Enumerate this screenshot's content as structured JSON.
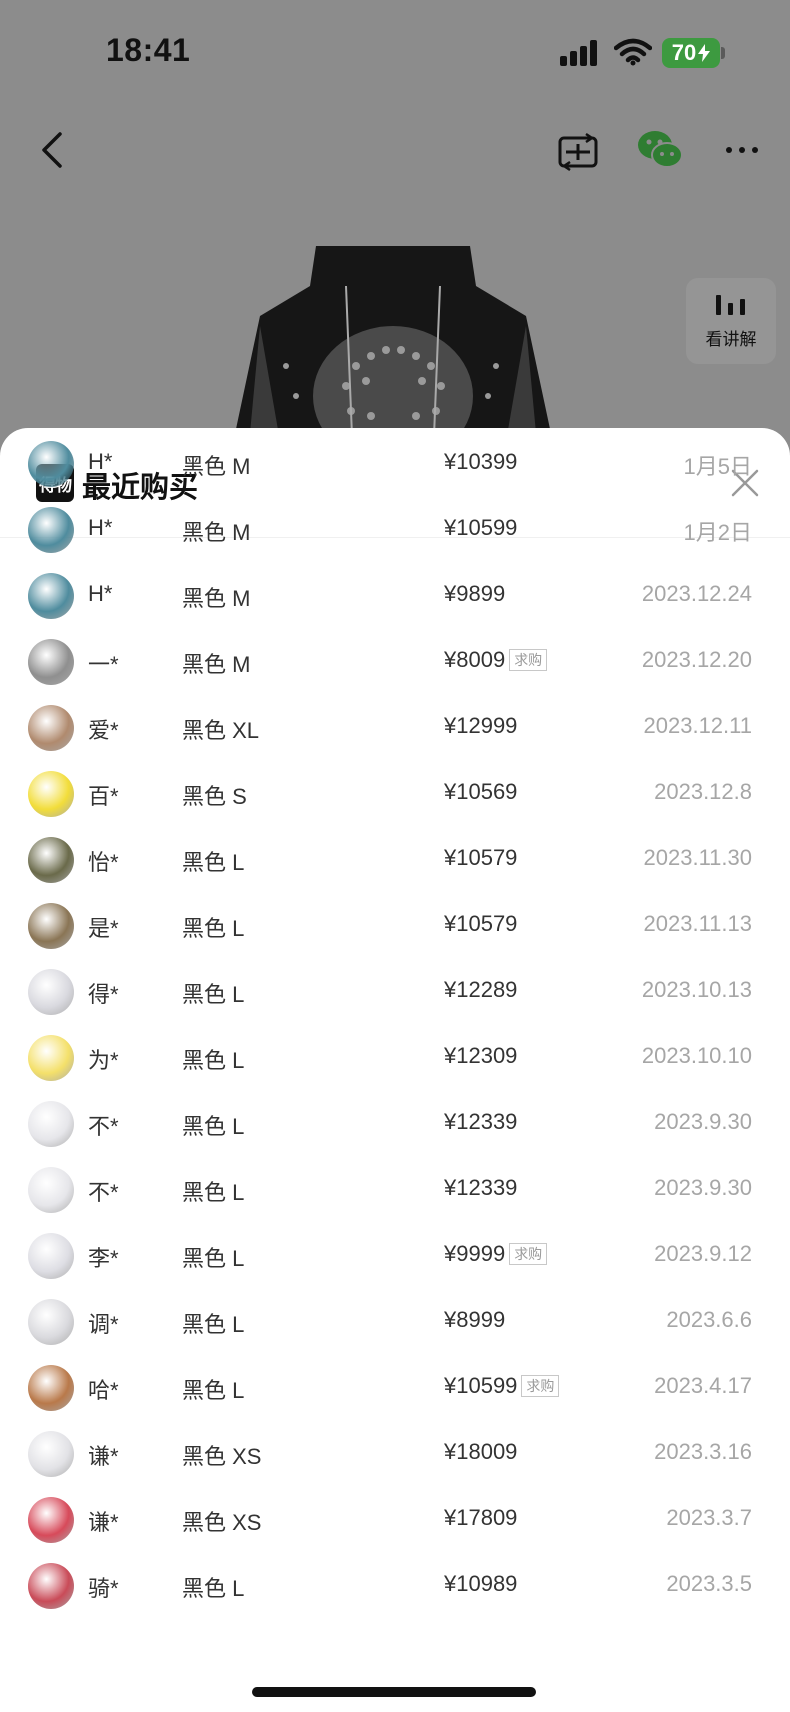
{
  "status_bar": {
    "time": "18:41",
    "battery": "70"
  },
  "nav": {
    "sell_label_icon": "sell-icon",
    "share_icon": "wechat-icon",
    "more_icon": "more-icon"
  },
  "explain": {
    "label": "看讲解"
  },
  "sheet": {
    "brand_logo": "得物",
    "title": "最近购买",
    "rows": [
      {
        "buyer": "H*",
        "spec": "黑色 M",
        "price": "¥10399",
        "tag": "",
        "date": "1月5日",
        "avatar_color": "#4f8c9e"
      },
      {
        "buyer": "H*",
        "spec": "黑色 M",
        "price": "¥10599",
        "tag": "",
        "date": "1月2日",
        "avatar_color": "#4f8c9e"
      },
      {
        "buyer": "H*",
        "spec": "黑色 M",
        "price": "¥9899",
        "tag": "",
        "date": "2023.12.24",
        "avatar_color": "#4f8c9e"
      },
      {
        "buyer": "一*",
        "spec": "黑色 M",
        "price": "¥8009",
        "tag": "求购",
        "date": "2023.12.20",
        "avatar_color": "#8f8f8f"
      },
      {
        "buyer": "爱*",
        "spec": "黑色 XL",
        "price": "¥12999",
        "tag": "",
        "date": "2023.12.11",
        "avatar_color": "#b08a6e"
      },
      {
        "buyer": "百*",
        "spec": "黑色 S",
        "price": "¥10569",
        "tag": "",
        "date": "2023.12.8",
        "avatar_color": "#f2dd3a"
      },
      {
        "buyer": "怡*",
        "spec": "黑色 L",
        "price": "¥10579",
        "tag": "",
        "date": "2023.11.30",
        "avatar_color": "#6a6a4a"
      },
      {
        "buyer": "是*",
        "spec": "黑色 L",
        "price": "¥10579",
        "tag": "",
        "date": "2023.11.13",
        "avatar_color": "#8a7555"
      },
      {
        "buyer": "得*",
        "spec": "黑色 L",
        "price": "¥12289",
        "tag": "",
        "date": "2023.10.13",
        "avatar_color": "#d9d9df"
      },
      {
        "buyer": "为*",
        "spec": "黑色 L",
        "price": "¥12309",
        "tag": "",
        "date": "2023.10.10",
        "avatar_color": "#f4e06a"
      },
      {
        "buyer": "不*",
        "spec": "黑色 L",
        "price": "¥12339",
        "tag": "",
        "date": "2023.9.30",
        "avatar_color": "#e6e6ea"
      },
      {
        "buyer": "不*",
        "spec": "黑色 L",
        "price": "¥12339",
        "tag": "",
        "date": "2023.9.30",
        "avatar_color": "#e6e6ea"
      },
      {
        "buyer": "李*",
        "spec": "黑色 L",
        "price": "¥9999",
        "tag": "求购",
        "date": "2023.9.12",
        "avatar_color": "#dedee4"
      },
      {
        "buyer": "调*",
        "spec": "黑色 L",
        "price": "¥8999",
        "tag": "",
        "date": "2023.6.6",
        "avatar_color": "#dadade"
      },
      {
        "buyer": "哈*",
        "spec": "黑色 L",
        "price": "¥10599",
        "tag": "求购",
        "date": "2023.4.17",
        "avatar_color": "#b9794a"
      },
      {
        "buyer": "谦*",
        "spec": "黑色 XS",
        "price": "¥18009",
        "tag": "",
        "date": "2023.3.16",
        "avatar_color": "#e2e2e6"
      },
      {
        "buyer": "谦*",
        "spec": "黑色 XS",
        "price": "¥17809",
        "tag": "",
        "date": "2023.3.7",
        "avatar_color": "#d74a5a"
      },
      {
        "buyer": "骑*",
        "spec": "黑色 L",
        "price": "¥10989",
        "tag": "",
        "date": "2023.3.5",
        "avatar_color": "#c94b58"
      }
    ]
  }
}
